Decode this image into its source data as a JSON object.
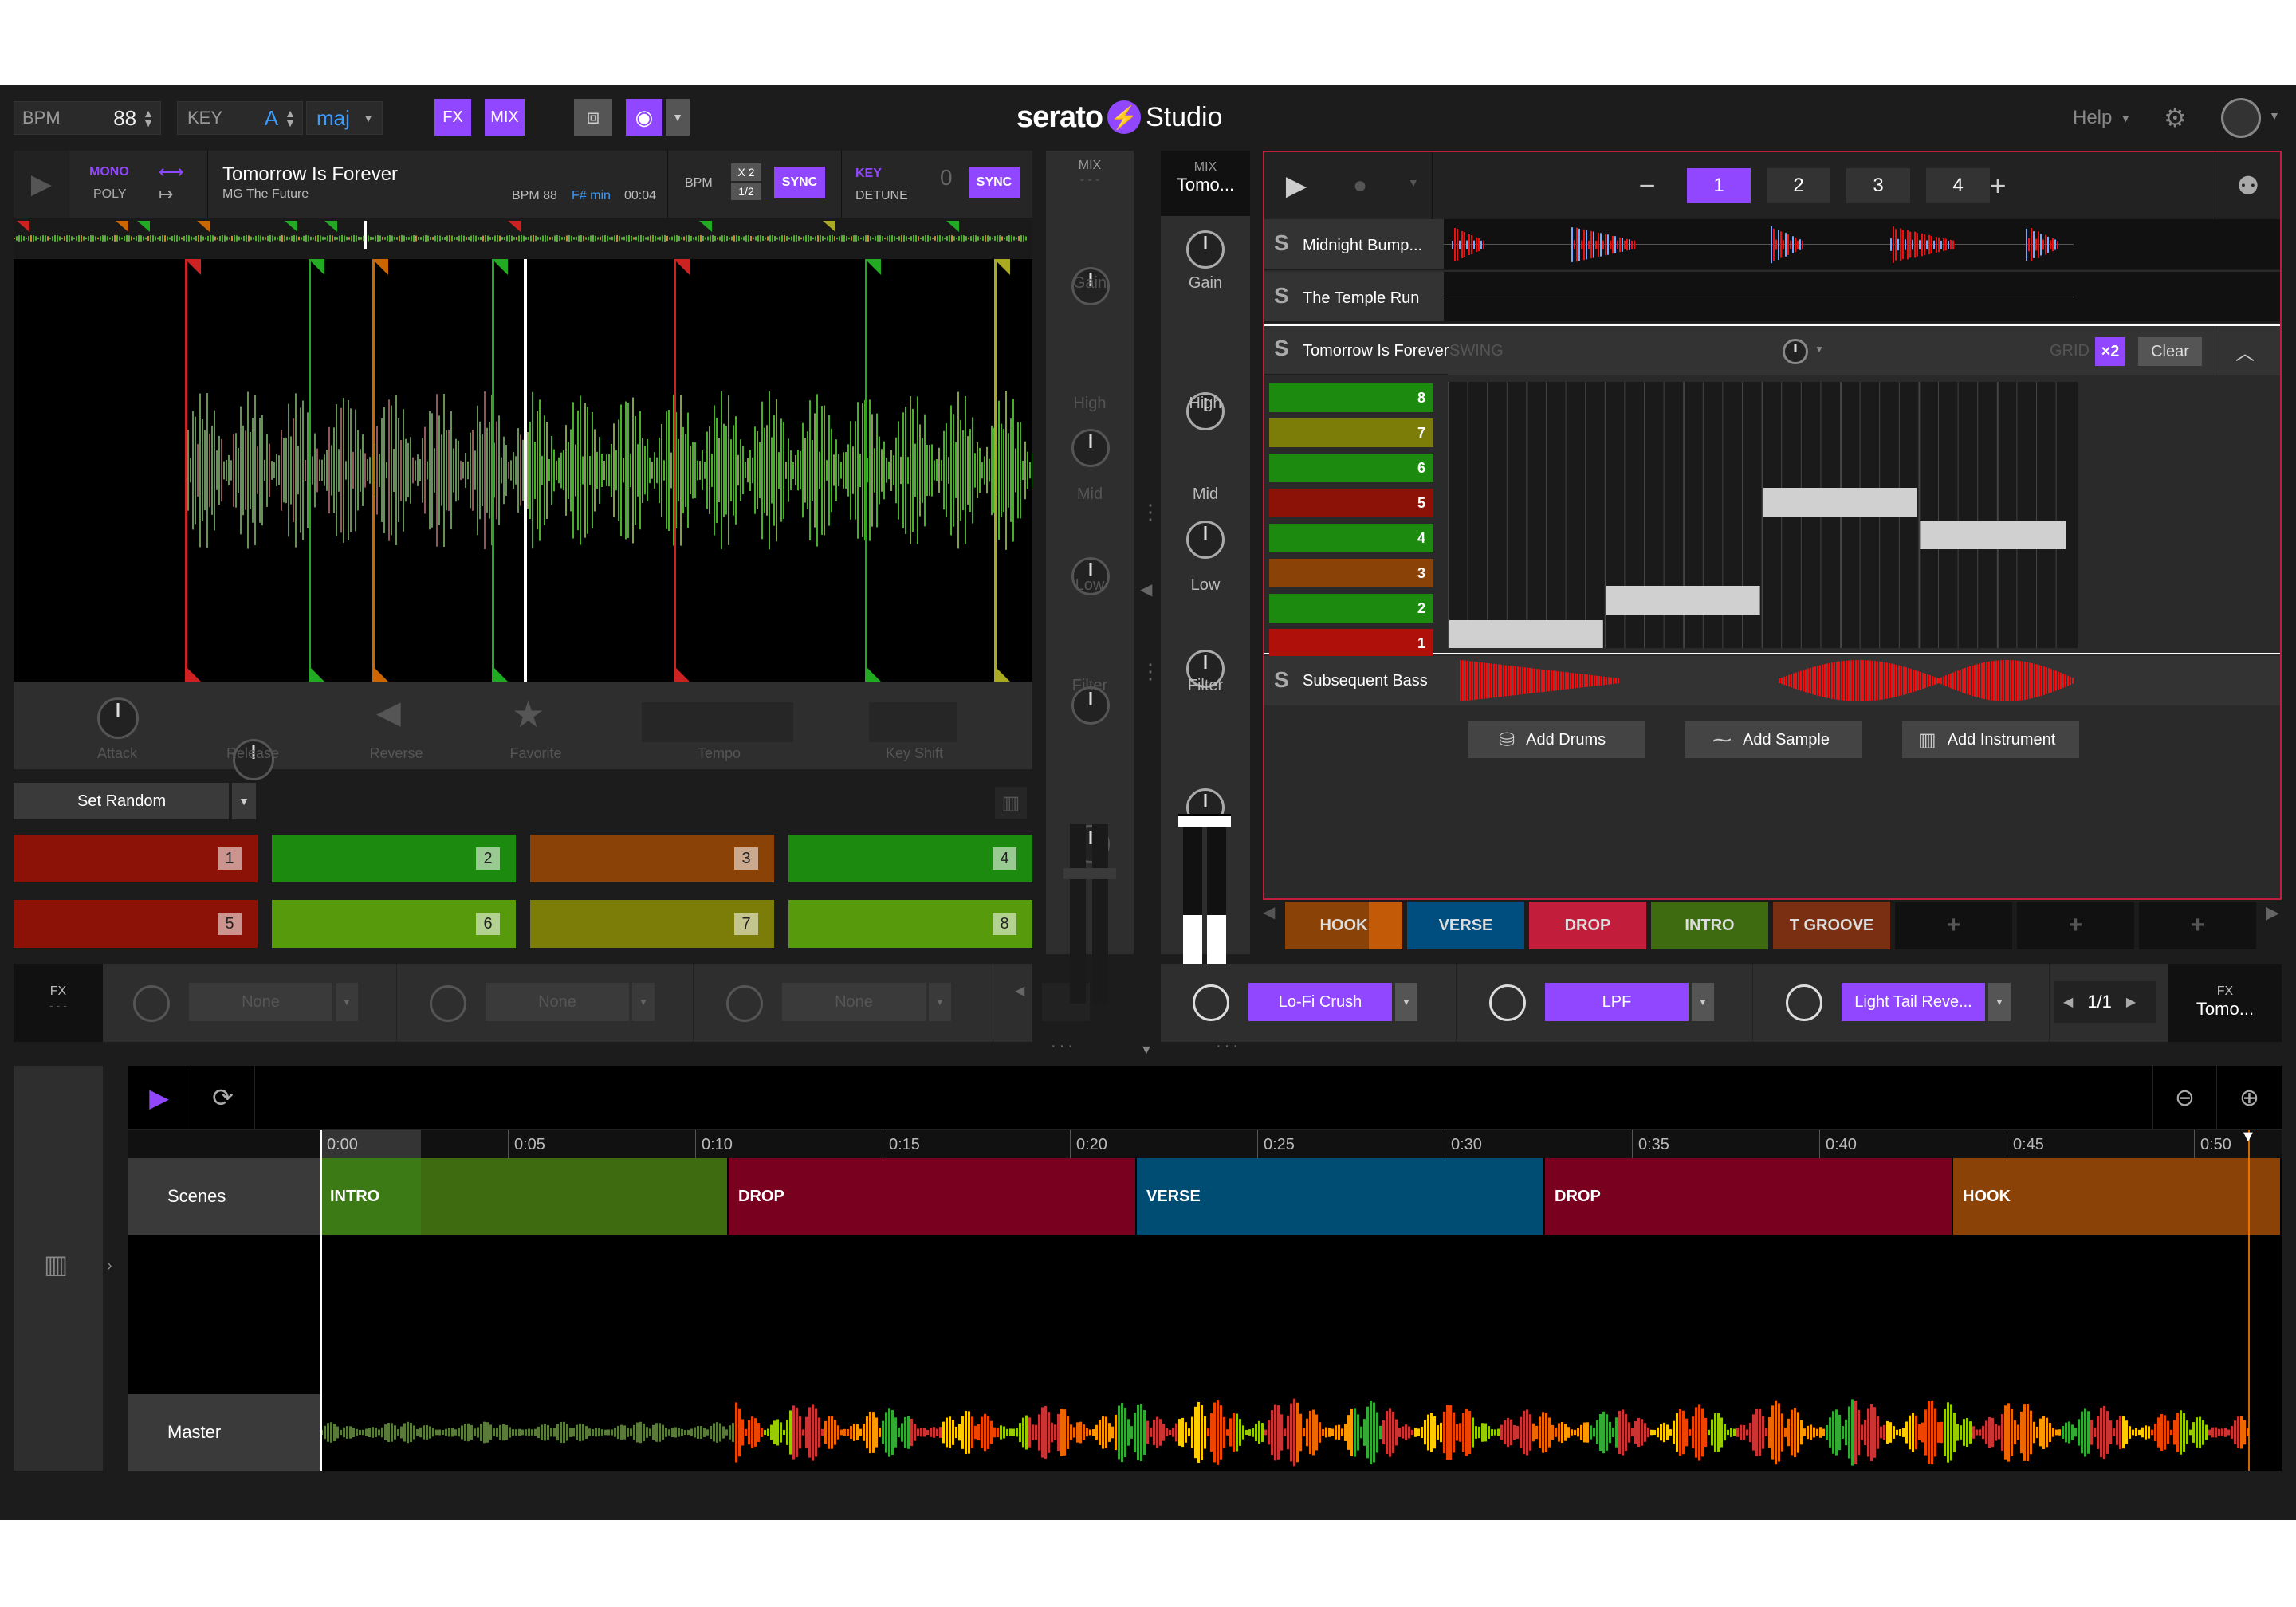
{
  "topbar": {
    "bpm_label": "BPM",
    "bpm_value": "88",
    "key_label": "KEY",
    "key_value": "A",
    "key_mode": "maj",
    "fx": "FX",
    "mix": "MIX",
    "brand": "serato",
    "brand2": "Studio",
    "help": "Help"
  },
  "deck": {
    "mono": "MONO",
    "poly": "POLY",
    "title": "Tomorrow Is Forever",
    "artist": "MG The Future",
    "bpm": "BPM 88",
    "key": "F# min",
    "time": "00:04",
    "bpm_label": "BPM",
    "x2": "X 2",
    "half": "1/2",
    "sync": "SYNC",
    "key_label": "KEY",
    "detune": "DETUNE",
    "detune_val": "0",
    "sync2": "SYNC"
  },
  "deck_controls": {
    "attack": "Attack",
    "release": "Release",
    "reverse": "Reverse",
    "favorite": "Favorite",
    "tempo": "Tempo",
    "key_shift": "Key Shift"
  },
  "pads": {
    "set_random": "Set Random",
    "labels": [
      "1",
      "2",
      "3",
      "4",
      "5",
      "6",
      "7",
      "8"
    ]
  },
  "fx_left": {
    "label": "FX",
    "dash": "- - -",
    "slots": [
      "None",
      "None",
      "None"
    ]
  },
  "mixer": {
    "left_label": "MIX",
    "left_dash": "- - -",
    "gain": "Gain",
    "high": "High",
    "mid": "Mid",
    "low": "Low",
    "filter": "Filter",
    "right_label": "MIX",
    "right_track": "Tomo..."
  },
  "sequencer": {
    "patterns": [
      "1",
      "2",
      "3",
      "4"
    ],
    "tracks": [
      "Midnight Bump...",
      "The Temple Run",
      "Tomorrow Is Forever",
      "Subsequent Bass"
    ],
    "swing": "SWING",
    "grid": "GRID",
    "x2": "×2",
    "clear": "Clear",
    "rows": [
      "8",
      "7",
      "6",
      "5",
      "4",
      "3",
      "2",
      "1"
    ],
    "add_drums": "Add Drums",
    "add_sample": "Add Sample",
    "add_instrument": "Add Instrument"
  },
  "scenes": [
    "HOOK",
    "VERSE",
    "DROP",
    "INTRO",
    "T GROOVE",
    "+",
    "+",
    "+"
  ],
  "fx_right": {
    "slots": [
      "Lo-Fi Crush",
      "LPF",
      "Light Tail Reve..."
    ],
    "page": "1/1",
    "label": "FX",
    "track": "Tomo..."
  },
  "timeline": {
    "ticks": [
      "0:00",
      "0:05",
      "0:10",
      "0:15",
      "0:20",
      "0:25",
      "0:30",
      "0:35",
      "0:40",
      "0:45",
      "0:50"
    ],
    "scenes_label": "Scenes",
    "master_label": "Master",
    "segments": [
      "INTRO",
      "DROP",
      "VERSE",
      "DROP",
      "HOOK"
    ]
  },
  "colors": {
    "accent": "#9147ff",
    "red": "#8c1207",
    "green": "#1c8a0e",
    "orange": "#8a4207",
    "olive": "#7c7d08"
  }
}
